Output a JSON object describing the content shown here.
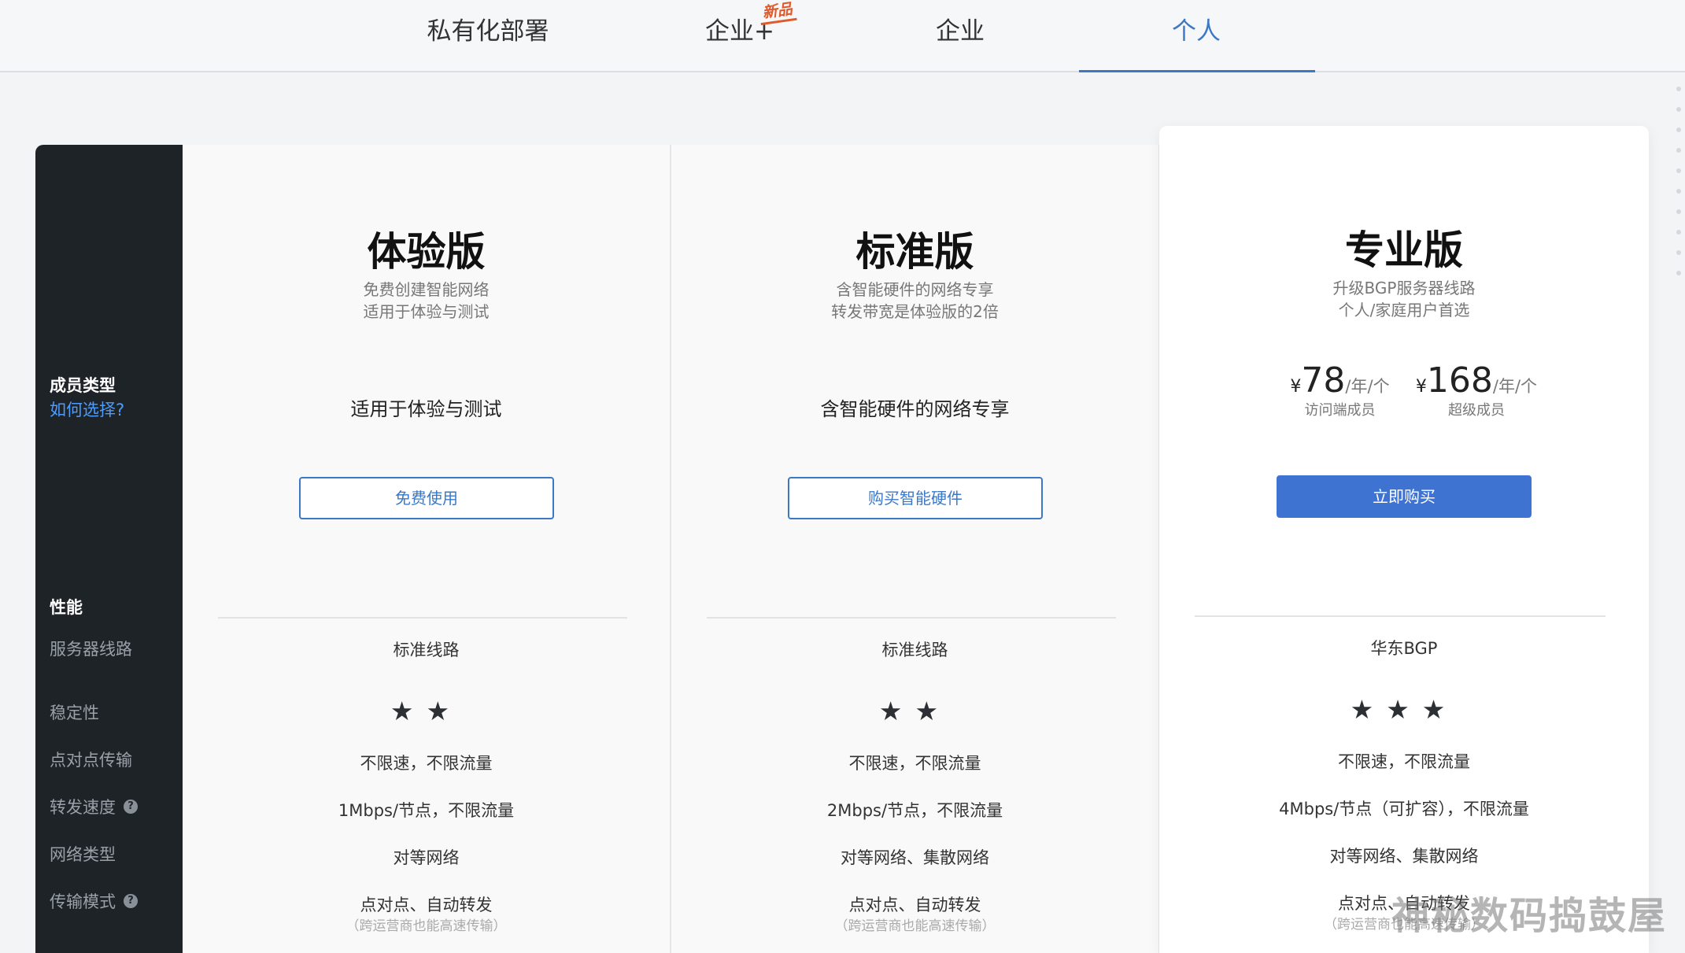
{
  "tabs": [
    {
      "label": "私有化部署"
    },
    {
      "label": "企业+",
      "badge": "新品"
    },
    {
      "label": "企业"
    },
    {
      "label": "个人",
      "active": true
    }
  ],
  "sidebar": {
    "member_type": "成员类型",
    "how_to_choose": "如何选择?",
    "performance": "性能",
    "rows": [
      "服务器线路",
      "稳定性",
      "点对点传输",
      "转发速度",
      "网络类型",
      "传输模式"
    ],
    "help_icon_glyph": "?"
  },
  "plans": [
    {
      "title": "体验版",
      "subtitle1": "免费创建智能网络",
      "subtitle2": "适用于体验与测试",
      "mid": "适用于体验与测试",
      "button": "免费使用",
      "server_line": "标准线路",
      "stars": "★★",
      "stars_count": 2,
      "p2p": "不限速，不限流量",
      "relay_speed": "1Mbps/节点，不限流量",
      "network_type": "对等网络",
      "transfer_mode": "点对点、自动转发",
      "transfer_note": "（跨运营商也能高速传输）"
    },
    {
      "title": "标准版",
      "subtitle1": "含智能硬件的网络专享",
      "subtitle2": "转发带宽是体验版的2倍",
      "mid": "含智能硬件的网络专享",
      "button": "购买智能硬件",
      "server_line": "标准线路",
      "stars": "★★",
      "stars_count": 2,
      "p2p": "不限速，不限流量",
      "relay_speed": "2Mbps/节点，不限流量",
      "network_type": "对等网络、集散网络",
      "transfer_mode": "点对点、自动转发",
      "transfer_note": "（跨运营商也能高速传输）"
    },
    {
      "title": "专业版",
      "subtitle1": "升级BGP服务器线路",
      "subtitle2": "个人/家庭用户首选",
      "price1": {
        "currency": "¥",
        "amount": "78",
        "unit": "/年/个",
        "label": "访问端成员"
      },
      "price2": {
        "currency": "¥",
        "amount": "168",
        "unit": "/年/个",
        "label": "超级成员"
      },
      "button": "立即购买",
      "server_line": "华东BGP",
      "stars": "★★★",
      "stars_count": 3,
      "p2p": "不限速，不限流量",
      "relay_speed": "4Mbps/节点（可扩容），不限流量",
      "network_type": "对等网络、集散网络",
      "transfer_mode": "点对点、自动转发",
      "transfer_note": "（跨运营商也能高速传输）"
    }
  ],
  "watermark": "神秘数码捣鼓屋",
  "colors": {
    "accent": "#3b78c8",
    "button": "#3f73d1",
    "sidebar": "#1e2328",
    "badge": "#e05a2b"
  }
}
